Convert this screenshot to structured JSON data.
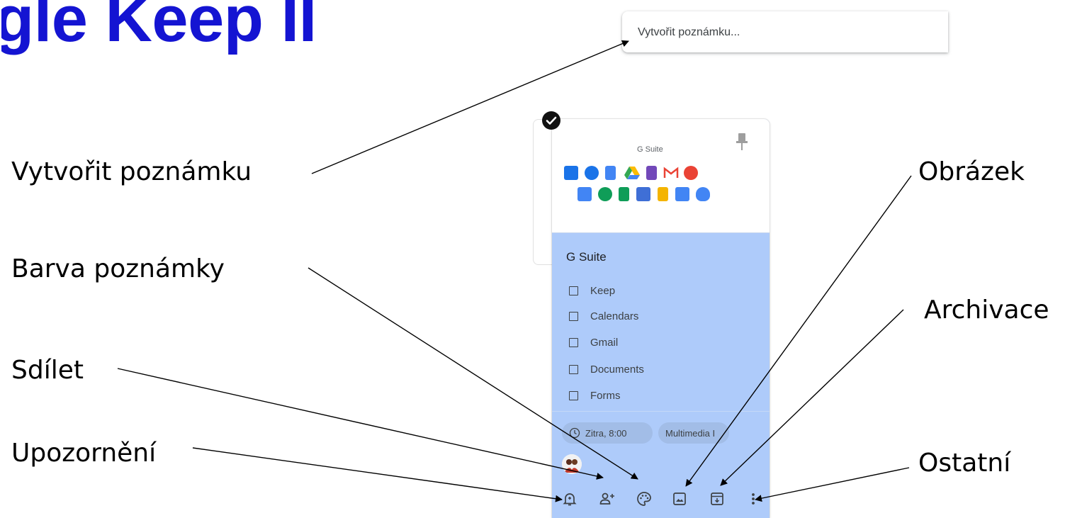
{
  "slide": {
    "title": "gle Keep II",
    "labels": {
      "create_note": "Vytvořit poznámku",
      "note_color": "Barva poznámky",
      "share": "Sdílet",
      "reminder": "Upozornění",
      "image": "Obrázek",
      "archive": "Archivace",
      "other": "Ostatní"
    }
  },
  "keep": {
    "search_placeholder": "Vytvořit poznámku...",
    "note": {
      "image_caption": "G Suite",
      "title": "G Suite",
      "items": [
        "Keep",
        "Calendars",
        "Gmail",
        "Documents",
        "Forms"
      ],
      "reminder_chip": "Zitra, 8:00",
      "label_chip": "Multimedia I"
    }
  },
  "colors": {
    "title": "#1414d2",
    "note_background": "#aecbfa"
  }
}
